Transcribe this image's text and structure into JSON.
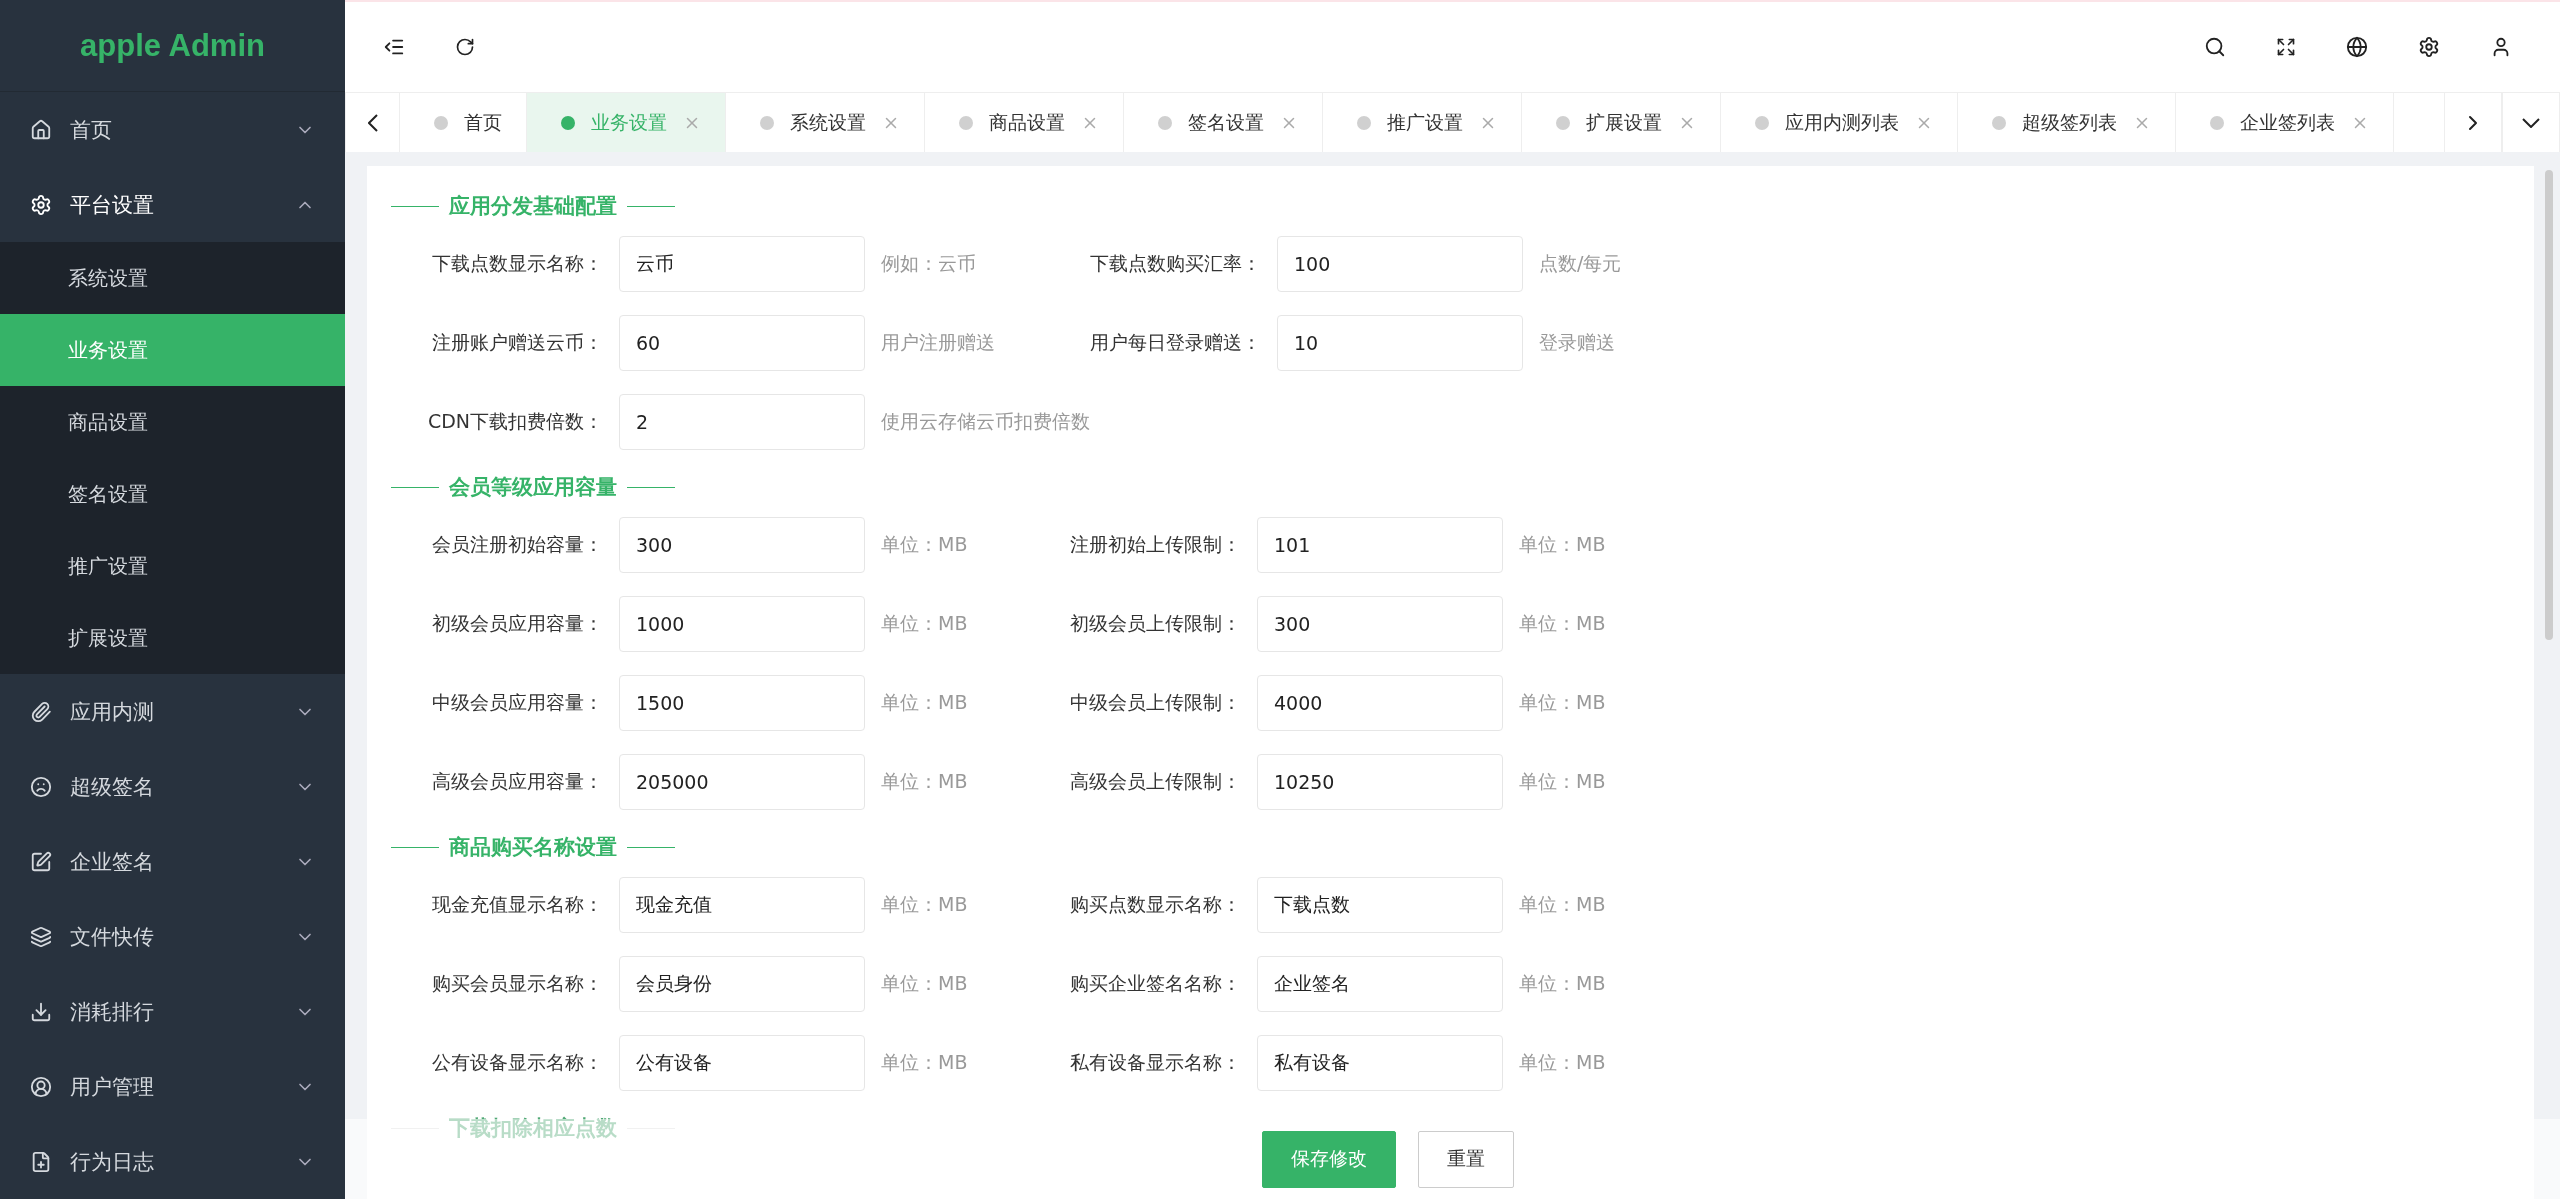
{
  "sidebar": {
    "logo": "apple Admin",
    "items": [
      {
        "label": "首页",
        "expanded": false
      },
      {
        "label": "平台设置",
        "expanded": true,
        "children": [
          {
            "label": "系统设置",
            "selected": false
          },
          {
            "label": "业务设置",
            "selected": true
          },
          {
            "label": "商品设置",
            "selected": false
          },
          {
            "label": "签名设置",
            "selected": false
          },
          {
            "label": "推广设置",
            "selected": false
          },
          {
            "label": "扩展设置",
            "selected": false
          }
        ]
      },
      {
        "label": "应用内测",
        "expanded": false
      },
      {
        "label": "超级签名",
        "expanded": false
      },
      {
        "label": "企业签名",
        "expanded": false
      },
      {
        "label": "文件快传",
        "expanded": false
      },
      {
        "label": "消耗排行",
        "expanded": false
      },
      {
        "label": "用户管理",
        "expanded": false
      },
      {
        "label": "行为日志",
        "expanded": false
      }
    ]
  },
  "tabs": [
    {
      "label": "首页",
      "selected": false,
      "closable": false
    },
    {
      "label": "业务设置",
      "selected": true,
      "closable": true
    },
    {
      "label": "系统设置",
      "selected": false,
      "closable": true
    },
    {
      "label": "商品设置",
      "selected": false,
      "closable": true
    },
    {
      "label": "签名设置",
      "selected": false,
      "closable": true
    },
    {
      "label": "推广设置",
      "selected": false,
      "closable": true
    },
    {
      "label": "扩展设置",
      "selected": false,
      "closable": true
    },
    {
      "label": "应用内测列表",
      "selected": false,
      "closable": true
    },
    {
      "label": "超级签列表",
      "selected": false,
      "closable": true
    },
    {
      "label": "企业签列表",
      "selected": false,
      "closable": true
    }
  ],
  "sections": [
    {
      "title": "应用分发基础配置",
      "faded": false,
      "rows": [
        [
          {
            "label": "下载点数显示名称：",
            "value": "云币",
            "hint": "例如：云币"
          },
          {
            "label": "下载点数购买汇率：",
            "value": "100",
            "hint": "点数/每元"
          }
        ],
        [
          {
            "label": "注册账户赠送云币：",
            "value": "60",
            "hint": "用户注册赠送"
          },
          {
            "label": "用户每日登录赠送：",
            "value": "10",
            "hint": "登录赠送"
          }
        ],
        [
          {
            "label": "CDN下载扣费倍数：",
            "value": "2",
            "hint": "使用云存储云币扣费倍数"
          }
        ]
      ]
    },
    {
      "title": "会员等级应用容量",
      "faded": false,
      "rows": [
        [
          {
            "label": "会员注册初始容量：",
            "value": "300",
            "hint": "单位：MB"
          },
          {
            "label": "注册初始上传限制：",
            "value": "101",
            "hint": "单位：MB"
          }
        ],
        [
          {
            "label": "初级会员应用容量：",
            "value": "1000",
            "hint": "单位：MB"
          },
          {
            "label": "初级会员上传限制：",
            "value": "300",
            "hint": "单位：MB"
          }
        ],
        [
          {
            "label": "中级会员应用容量：",
            "value": "1500",
            "hint": "单位：MB"
          },
          {
            "label": "中级会员上传限制：",
            "value": "4000",
            "hint": "单位：MB"
          }
        ],
        [
          {
            "label": "高级会员应用容量：",
            "value": "205000",
            "hint": "单位：MB"
          },
          {
            "label": "高级会员上传限制：",
            "value": "10250",
            "hint": "单位：MB"
          }
        ]
      ]
    },
    {
      "title": "商品购买名称设置",
      "faded": false,
      "rows": [
        [
          {
            "label": "现金充值显示名称：",
            "value": "现金充值",
            "hint": "单位：MB"
          },
          {
            "label": "购买点数显示名称：",
            "value": "下载点数",
            "hint": "单位：MB"
          }
        ],
        [
          {
            "label": "购买会员显示名称：",
            "value": "会员身份",
            "hint": "单位：MB"
          },
          {
            "label": "购买企业签名名称：",
            "value": "企业签名",
            "hint": "单位：MB"
          }
        ],
        [
          {
            "label": "公有设备显示名称：",
            "value": "公有设备",
            "hint": "单位：MB"
          },
          {
            "label": "私有设备显示名称：",
            "value": "私有设备",
            "hint": "单位：MB"
          }
        ]
      ]
    },
    {
      "title": "下载扣除相应点数",
      "faded": true
    }
  ],
  "footer": {
    "buttons": [
      {
        "label": "保存修改",
        "kind": "primary"
      },
      {
        "label": "重置",
        "kind": "default"
      }
    ]
  }
}
